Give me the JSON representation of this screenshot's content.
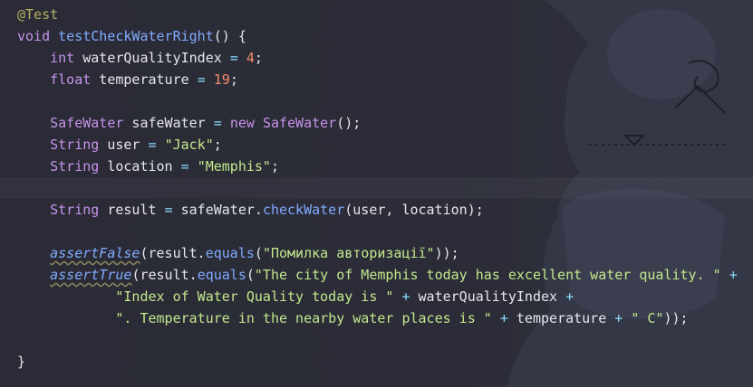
{
  "editor": {
    "lines": [
      {
        "tokens": [
          {
            "t": "@Test",
            "c": "ann"
          }
        ]
      },
      {
        "tokens": [
          {
            "t": "void",
            "c": "kw"
          },
          {
            "t": " ",
            "c": "pun"
          },
          {
            "t": "testCheckWaterRight",
            "c": "fn"
          },
          {
            "t": "() {",
            "c": "pun"
          }
        ]
      },
      {
        "tokens": [
          {
            "t": "    ",
            "c": "pun"
          },
          {
            "t": "int",
            "c": "kw"
          },
          {
            "t": " waterQualityIndex ",
            "c": "pun"
          },
          {
            "t": "=",
            "c": "op"
          },
          {
            "t": " ",
            "c": "pun"
          },
          {
            "t": "4",
            "c": "num"
          },
          {
            "t": ";",
            "c": "pun"
          }
        ]
      },
      {
        "tokens": [
          {
            "t": "    ",
            "c": "pun"
          },
          {
            "t": "float",
            "c": "kw"
          },
          {
            "t": " temperature ",
            "c": "pun"
          },
          {
            "t": "=",
            "c": "op"
          },
          {
            "t": " ",
            "c": "pun"
          },
          {
            "t": "19",
            "c": "num"
          },
          {
            "t": ";",
            "c": "pun"
          }
        ]
      },
      {
        "tokens": []
      },
      {
        "tokens": [
          {
            "t": "    ",
            "c": "pun"
          },
          {
            "t": "SafeWater",
            "c": "typ"
          },
          {
            "t": " safeWater ",
            "c": "pun"
          },
          {
            "t": "=",
            "c": "op"
          },
          {
            "t": " ",
            "c": "pun"
          },
          {
            "t": "new",
            "c": "kw"
          },
          {
            "t": " ",
            "c": "pun"
          },
          {
            "t": "SafeWater",
            "c": "typ"
          },
          {
            "t": "();",
            "c": "pun"
          }
        ]
      },
      {
        "tokens": [
          {
            "t": "    ",
            "c": "pun"
          },
          {
            "t": "String",
            "c": "typ"
          },
          {
            "t": " user ",
            "c": "pun"
          },
          {
            "t": "=",
            "c": "op"
          },
          {
            "t": " ",
            "c": "pun"
          },
          {
            "t": "\"Jack\"",
            "c": "str"
          },
          {
            "t": ";",
            "c": "pun"
          }
        ]
      },
      {
        "tokens": [
          {
            "t": "    ",
            "c": "pun"
          },
          {
            "t": "String",
            "c": "typ"
          },
          {
            "t": " location ",
            "c": "pun"
          },
          {
            "t": "=",
            "c": "op"
          },
          {
            "t": " ",
            "c": "pun"
          },
          {
            "t": "\"Memphis\"",
            "c": "str"
          },
          {
            "t": ";",
            "c": "pun"
          }
        ]
      },
      {
        "tokens": []
      },
      {
        "tokens": [
          {
            "t": "    ",
            "c": "pun"
          },
          {
            "t": "String",
            "c": "typ"
          },
          {
            "t": " result ",
            "c": "pun"
          },
          {
            "t": "=",
            "c": "op"
          },
          {
            "t": " safeWater.",
            "c": "pun"
          },
          {
            "t": "checkWater",
            "c": "fn"
          },
          {
            "t": "(user, location);",
            "c": "pun"
          }
        ]
      },
      {
        "tokens": []
      },
      {
        "tokens": [
          {
            "t": "    ",
            "c": "pun"
          },
          {
            "t": "assertFalse",
            "c": "call"
          },
          {
            "t": "(result.",
            "c": "pun"
          },
          {
            "t": "equals",
            "c": "fn"
          },
          {
            "t": "(",
            "c": "pun"
          },
          {
            "t": "\"Помилка авторизації\"",
            "c": "str"
          },
          {
            "t": "));",
            "c": "pun"
          }
        ]
      },
      {
        "tokens": [
          {
            "t": "    ",
            "c": "pun"
          },
          {
            "t": "assertTrue",
            "c": "call"
          },
          {
            "t": "(result.",
            "c": "pun"
          },
          {
            "t": "equals",
            "c": "fn"
          },
          {
            "t": "(",
            "c": "pun"
          },
          {
            "t": "\"The city of Memphis today has excellent water quality. \"",
            "c": "str"
          },
          {
            "t": " ",
            "c": "pun"
          },
          {
            "t": "+",
            "c": "op"
          }
        ]
      },
      {
        "tokens": [
          {
            "t": "            ",
            "c": "pun"
          },
          {
            "t": "\"Index of Water Quality today is \"",
            "c": "str"
          },
          {
            "t": " ",
            "c": "pun"
          },
          {
            "t": "+",
            "c": "op"
          },
          {
            "t": " waterQualityIndex ",
            "c": "pun"
          },
          {
            "t": "+",
            "c": "op"
          }
        ]
      },
      {
        "tokens": [
          {
            "t": "            ",
            "c": "pun"
          },
          {
            "t": "\". Temperature in the nearby water places is \"",
            "c": "str"
          },
          {
            "t": " ",
            "c": "pun"
          },
          {
            "t": "+",
            "c": "op"
          },
          {
            "t": " temperature ",
            "c": "pun"
          },
          {
            "t": "+",
            "c": "op"
          },
          {
            "t": " ",
            "c": "pun"
          },
          {
            "t": "\" C\"",
            "c": "str"
          },
          {
            "t": "));",
            "c": "pun"
          }
        ]
      },
      {
        "tokens": []
      },
      {
        "tokens": [
          {
            "t": "}",
            "c": "pun"
          }
        ]
      }
    ]
  },
  "colors": {
    "background": "#2b2c37",
    "annotation": "#b3ae60",
    "keyword": "#c792ea",
    "number": "#f78c6c",
    "string": "#c3e88d",
    "function": "#82aaff",
    "plain": "#e6e6ef"
  }
}
